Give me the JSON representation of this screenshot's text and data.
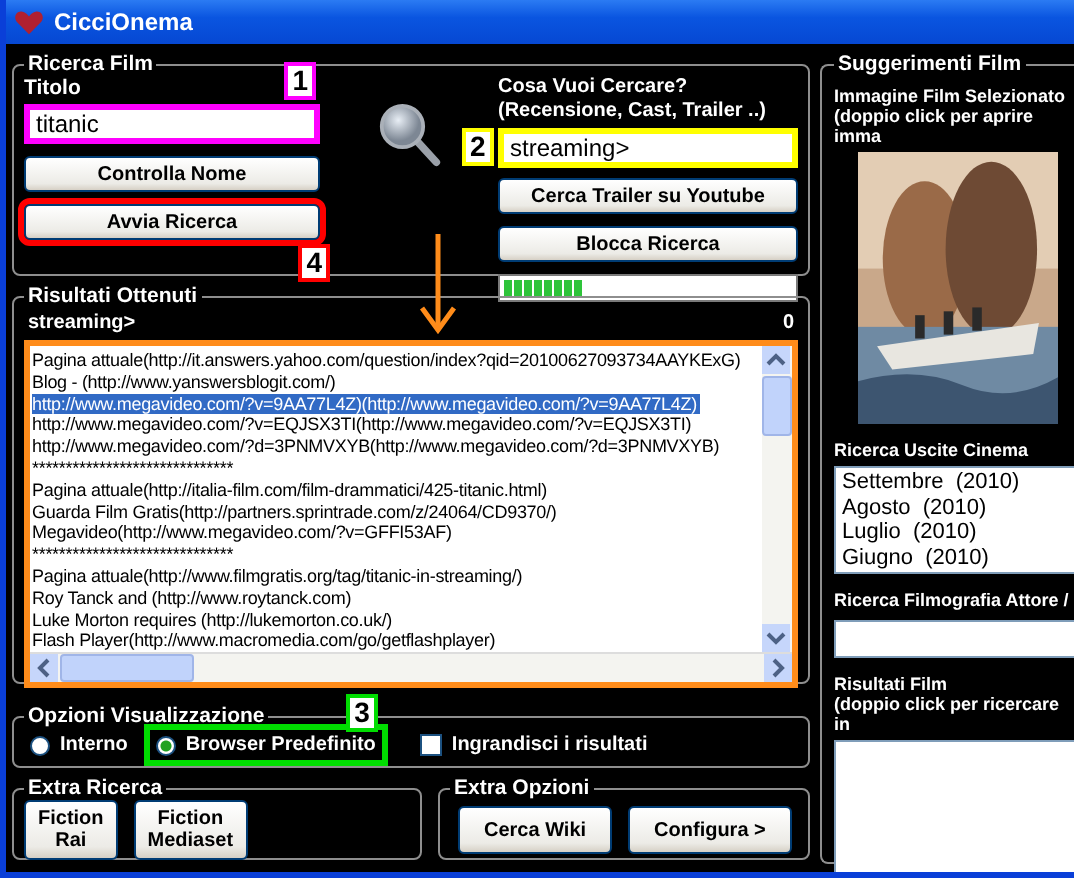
{
  "window": {
    "title": "CicciOnema"
  },
  "ricerca_film": {
    "title": "Ricerca Film",
    "titolo_label": "Titolo",
    "titolo_value": "titanic",
    "titolo_callout": {
      "label": "1",
      "color": "#ff00ff"
    },
    "controlla_button": "Controlla Nome",
    "avvia_button": "Avvia Ricerca",
    "avvia_callout": {
      "label": "4",
      "color": "#ff0000"
    },
    "cosa_label": "Cosa Vuoi Cercare?",
    "cosa_hint": "(Recensione, Cast, Trailer ..)",
    "cosa_value": "streaming>",
    "cosa_callout": {
      "label": "2",
      "color": "#ffff00"
    },
    "trailer_button": "Cerca Trailer su Youtube",
    "blocca_button": "Blocca Ricerca",
    "progress": {
      "level": 0.28
    }
  },
  "risultati": {
    "title": "Risultati Ottenuti",
    "query": "streaming>",
    "count": "0",
    "lines": [
      {
        "text": "Pagina attuale(http://it.answers.yahoo.com/question/index?qid=20100627093734AAYKExG)",
        "selected": false
      },
      {
        "text": "Blog - (http://www.yanswersblogit.com/)",
        "selected": false
      },
      {
        "text": "http://www.megavideo.com/?v=9AA77L4Z)(http://www.megavideo.com/?v=9AA77L4Z)",
        "selected": true
      },
      {
        "text": "http://www.megavideo.com/?v=EQJSX3TI(http://www.megavideo.com/?v=EQJSX3TI)",
        "selected": false
      },
      {
        "text": "http://www.megavideo.com/?d=3PNMVXYB(http://www.megavideo.com/?d=3PNMVXYB)",
        "selected": false
      },
      {
        "text": "******************************",
        "selected": false
      },
      {
        "text": "Pagina attuale(http://italia-film.com/film-drammatici/425-titanic.html)",
        "selected": false
      },
      {
        "text": "Guarda Film Gratis(http://partners.sprintrade.com/z/24064/CD9370/)",
        "selected": false
      },
      {
        "text": "Megavideo(http://www.megavideo.com/?v=GFFI53AF)",
        "selected": false
      },
      {
        "text": "******************************",
        "selected": false
      },
      {
        "text": "Pagina attuale(http://www.filmgratis.org/tag/titanic-in-streaming/)",
        "selected": false
      },
      {
        "text": "Roy Tanck and (http://www.roytanck.com)",
        "selected": false
      },
      {
        "text": "Luke Morton requires (http://lukemorton.co.uk/)",
        "selected": false
      },
      {
        "text": "Flash Player(http://www.macromedia.com/go/getflashplayer)",
        "selected": false
      }
    ]
  },
  "opzioni": {
    "title": "Opzioni Visualizzazione",
    "radios": [
      {
        "label": "Interno",
        "selected": false
      },
      {
        "label": "Browser Predefinito",
        "selected": true,
        "callout": {
          "label": "3",
          "color": "#00dd00"
        }
      }
    ],
    "checkbox": {
      "label": "Ingrandisci i risultati",
      "checked": false
    }
  },
  "extra_ricerca": {
    "title": "Extra Ricerca",
    "buttons": [
      "Fiction Rai",
      "Fiction Mediaset"
    ]
  },
  "extra_opzioni": {
    "title": "Extra Opzioni",
    "buttons": [
      "Cerca Wiki",
      "Configura >"
    ]
  },
  "suggerimenti": {
    "title": "Suggerimenti Film",
    "image_label": "Immagine Film Selezionato",
    "image_hint": "(doppio click per aprire imma",
    "uscite_label": "Ricerca Uscite Cinema",
    "uscite": [
      "Settembre  (2010)",
      "Agosto  (2010)",
      "Luglio  (2010)",
      "Giugno  (2010)"
    ],
    "filmografia_label": "Ricerca Filmografia Attore /",
    "risultati_label": "Risultati Film",
    "risultati_hint": "(doppio click per ricercare in"
  }
}
